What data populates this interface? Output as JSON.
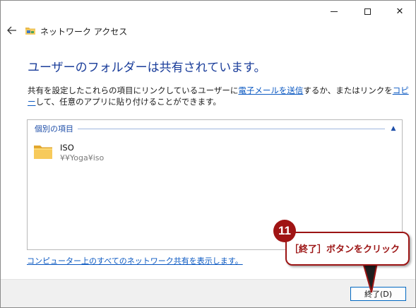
{
  "window": {
    "title": "ネットワーク アクセス",
    "minimize_icon": "minimize-icon",
    "maximize_icon": "maximize-icon",
    "close_glyph": "✕"
  },
  "main": {
    "heading": "ユーザーのフォルダーは共有されています。",
    "desc_part1": "共有を設定したこれらの項目にリンクしているユーザーに",
    "desc_link_email": "電子メールを送信",
    "desc_part2": "するか、またはリンクを",
    "desc_link_copy": "コピー",
    "desc_part3": "して、任意のアプリに貼り付けることができます。"
  },
  "items_box": {
    "group_label": "個別の項目",
    "collapse_glyph": "▲",
    "items": [
      {
        "name": "ISO",
        "path": "¥¥Yoga¥iso",
        "icon": "folder-icon"
      }
    ]
  },
  "bottom_link": "コンピューター上のすべてのネットワーク共有を表示します。",
  "footer": {
    "finish_label": "終了(D)"
  },
  "annotation": {
    "step_number": "11",
    "text": "［終了］ボタンをクリック",
    "color": "#9c1414"
  },
  "colors": {
    "heading": "#1a3d9a",
    "link": "#0a58c2",
    "button_border": "#0067c0"
  }
}
